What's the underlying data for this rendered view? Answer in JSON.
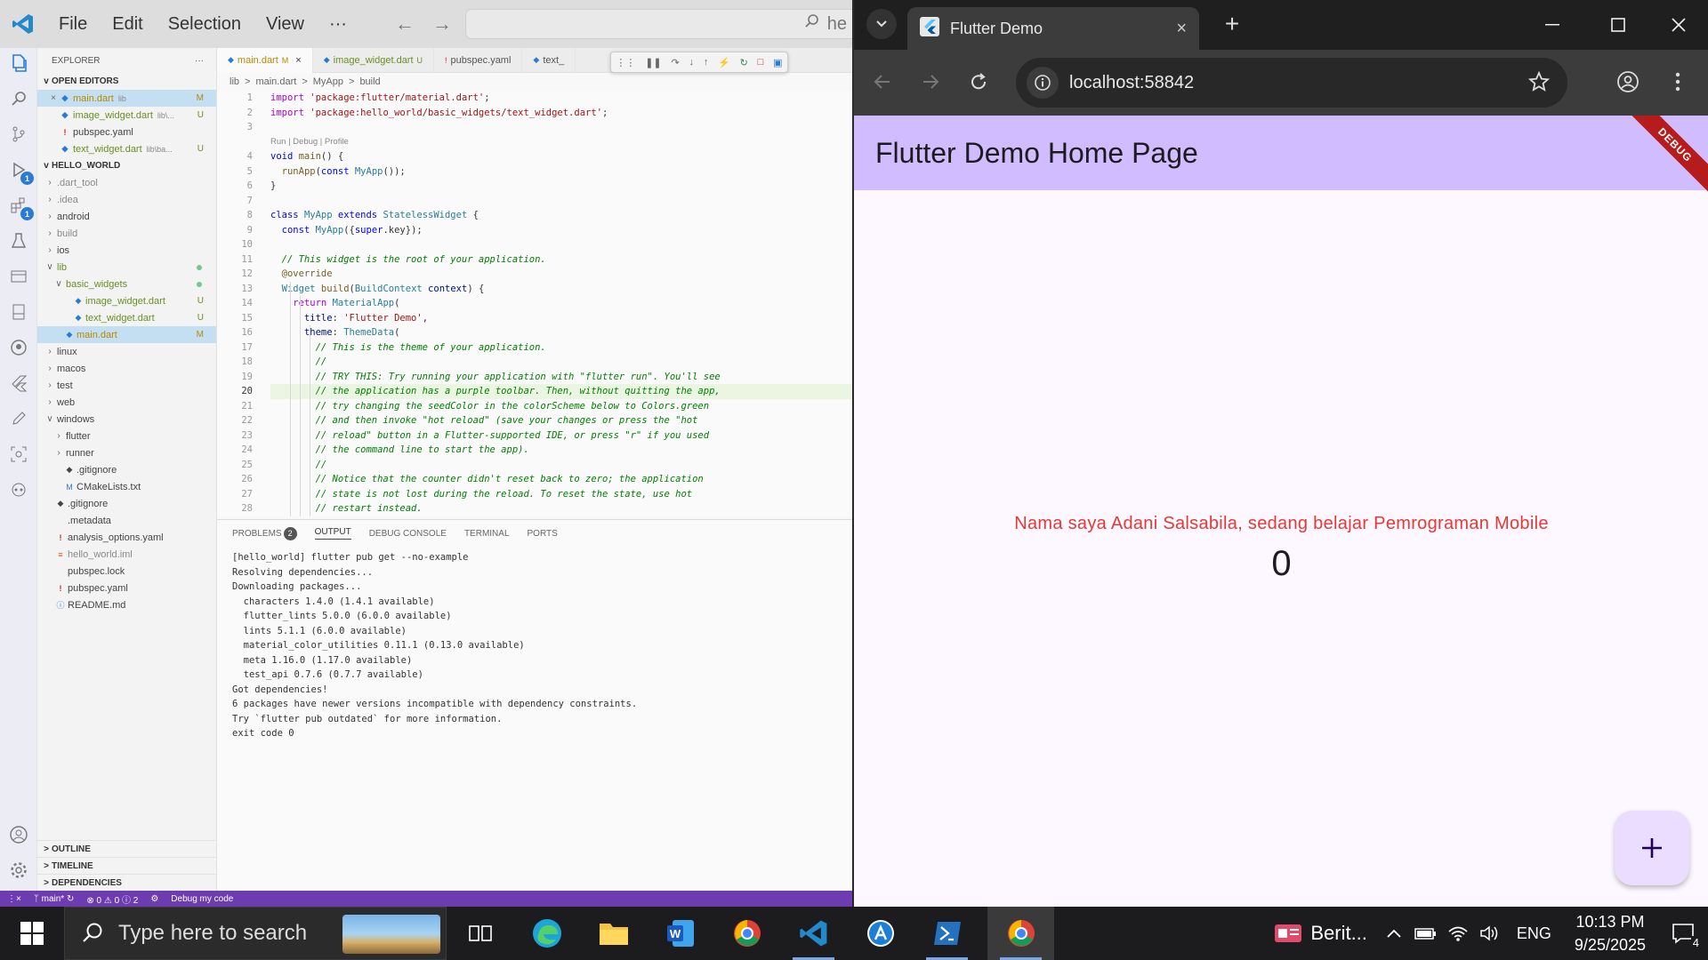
{
  "vscode": {
    "menu": [
      "File",
      "Edit",
      "Selection",
      "View",
      "···"
    ],
    "search_text": "he",
    "explorer_title": "EXPLORER",
    "open_editors_label": "OPEN EDITORS",
    "open_editors": [
      {
        "name": "main.dart",
        "detail": "lib",
        "status": "M",
        "close": true
      },
      {
        "name": "image_widget.dart",
        "detail": "lib\\...",
        "status": "U"
      },
      {
        "name": "pubspec.yaml",
        "detail": "",
        "status": ""
      },
      {
        "name": "text_widget.dart",
        "detail": "lib\\ba...",
        "status": "U"
      }
    ],
    "project_label": "HELLO_WORLD",
    "tree": [
      {
        "name": ".dart_tool",
        "indent": 0,
        "chev": ">",
        "color": "dim"
      },
      {
        "name": ".idea",
        "indent": 0,
        "chev": ">",
        "color": "dim"
      },
      {
        "name": "android",
        "indent": 0,
        "chev": ">"
      },
      {
        "name": "build",
        "indent": 0,
        "chev": ">",
        "color": "dim"
      },
      {
        "name": "ios",
        "indent": 0,
        "chev": ">"
      },
      {
        "name": "lib",
        "indent": 0,
        "chev": "v",
        "color": "grn",
        "dot": true
      },
      {
        "name": "basic_widgets",
        "indent": 1,
        "chev": "v",
        "color": "grn",
        "dot": true
      },
      {
        "name": "image_widget.dart",
        "indent": 2,
        "chev": "",
        "color": "grn",
        "status": "U"
      },
      {
        "name": "text_widget.dart",
        "indent": 2,
        "chev": "",
        "color": "grn",
        "status": "U"
      },
      {
        "name": "main.dart",
        "indent": 1,
        "chev": "",
        "color": "yel",
        "status": "M",
        "selected": true
      },
      {
        "name": "linux",
        "indent": 0,
        "chev": ">"
      },
      {
        "name": "macos",
        "indent": 0,
        "chev": ">"
      },
      {
        "name": "test",
        "indent": 0,
        "chev": ">"
      },
      {
        "name": "web",
        "indent": 0,
        "chev": ">"
      },
      {
        "name": "windows",
        "indent": 0,
        "chev": "v"
      },
      {
        "name": "flutter",
        "indent": 1,
        "chev": ">"
      },
      {
        "name": "runner",
        "indent": 1,
        "chev": ">"
      },
      {
        "name": ".gitignore",
        "indent": 1,
        "chev": ""
      },
      {
        "name": "CMakeLists.txt",
        "indent": 1,
        "chev": ""
      },
      {
        "name": ".gitignore",
        "indent": 0,
        "chev": ""
      },
      {
        "name": ".metadata",
        "indent": 0,
        "chev": ""
      },
      {
        "name": "analysis_options.yaml",
        "indent": 0,
        "chev": ""
      },
      {
        "name": "hello_world.iml",
        "indent": 0,
        "chev": "",
        "color": "dim"
      },
      {
        "name": "pubspec.lock",
        "indent": 0,
        "chev": ""
      },
      {
        "name": "pubspec.yaml",
        "indent": 0,
        "chev": ""
      },
      {
        "name": "README.md",
        "indent": 0,
        "chev": ""
      }
    ],
    "bottom_sections": [
      "OUTLINE",
      "TIMELINE",
      "DEPENDENCIES"
    ],
    "tabs": [
      {
        "name": "main.dart",
        "status": "M",
        "close": "×",
        "active": true
      },
      {
        "name": "image_widget.dart",
        "status": "U"
      },
      {
        "name": "pubspec.yaml",
        "status": ""
      },
      {
        "name": "text_",
        "status": ""
      }
    ],
    "breadcrumb": [
      "lib",
      ">",
      "main.dart",
      ">",
      "MyApp",
      ">",
      "build"
    ],
    "code_lens": "Run | Debug | Profile",
    "code": [
      [
        [
          "import ",
          "kp"
        ],
        [
          "'package:flutter/material.dart'",
          "str"
        ],
        [
          ";",
          ""
        ]
      ],
      [
        [
          "import ",
          "kp"
        ],
        [
          "'package:hello_world/basic_widgets/text_widget.dart'",
          "str"
        ],
        [
          ";",
          ""
        ]
      ],
      [],
      [
        [
          "void ",
          "kw"
        ],
        [
          "main",
          "fn"
        ],
        [
          "() {",
          ""
        ]
      ],
      [
        [
          "  ",
          ""
        ],
        [
          "runApp",
          "fn"
        ],
        [
          "(",
          ""
        ],
        [
          "const ",
          "kw"
        ],
        [
          "MyApp",
          "cls"
        ],
        [
          "());",
          ""
        ]
      ],
      [
        [
          "}",
          ""
        ]
      ],
      [],
      [
        [
          "class ",
          "kw"
        ],
        [
          "MyApp ",
          "cls"
        ],
        [
          "extends ",
          "kw"
        ],
        [
          "StatelessWidget ",
          "cls"
        ],
        [
          "{",
          ""
        ]
      ],
      [
        [
          "  ",
          ""
        ],
        [
          "const ",
          "kw"
        ],
        [
          "MyApp",
          "cls"
        ],
        [
          "({",
          ""
        ],
        [
          "super",
          "kw"
        ],
        [
          ".key});",
          ""
        ]
      ],
      [],
      [
        [
          "  // This widget is the root of your application.",
          "cmt"
        ]
      ],
      [
        [
          "  @override",
          "ann"
        ]
      ],
      [
        [
          "  ",
          ""
        ],
        [
          "Widget ",
          "cls"
        ],
        [
          "build",
          "fn"
        ],
        [
          "(",
          ""
        ],
        [
          "BuildContext ",
          "cls"
        ],
        [
          "context",
          "prm"
        ],
        [
          ") {",
          ""
        ]
      ],
      [
        [
          "    ",
          ""
        ],
        [
          "return ",
          "kp"
        ],
        [
          "MaterialApp",
          "cls"
        ],
        [
          "(",
          ""
        ]
      ],
      [
        [
          "      ",
          ""
        ],
        [
          "title",
          "prm"
        ],
        [
          ": ",
          ""
        ],
        [
          "'Flutter Demo'",
          "str"
        ],
        [
          ",",
          ""
        ]
      ],
      [
        [
          "      ",
          ""
        ],
        [
          "theme",
          "prm"
        ],
        [
          ": ",
          ""
        ],
        [
          "ThemeData",
          "cls"
        ],
        [
          "(",
          ""
        ]
      ],
      [
        [
          "        // This is the theme of your application.",
          "cmt"
        ]
      ],
      [
        [
          "        //",
          "cmt"
        ]
      ],
      [
        [
          "        // TRY THIS: Try running your application with \"flutter run\". You'll see",
          "cmt"
        ]
      ],
      [
        [
          "        // the application has a purple toolbar. Then, without quitting the app,",
          "cmt"
        ]
      ],
      [
        [
          "        // try changing the seedColor in the colorScheme below to Colors.green",
          "cmt"
        ]
      ],
      [
        [
          "        // and then invoke \"hot reload\" (save your changes or press the \"hot",
          "cmt"
        ]
      ],
      [
        [
          "        // reload\" button in a Flutter-supported IDE, or press \"r\" if you used",
          "cmt"
        ]
      ],
      [
        [
          "        // the command line to start the app).",
          "cmt"
        ]
      ],
      [
        [
          "        //",
          "cmt"
        ]
      ],
      [
        [
          "        // Notice that the counter didn't reset back to zero; the application",
          "cmt"
        ]
      ],
      [
        [
          "        // state is not lost during the reload. To reset the state, use hot",
          "cmt"
        ]
      ],
      [
        [
          "        // restart instead.",
          "cmt"
        ]
      ]
    ],
    "panel_tabs": [
      "PROBLEMS",
      "OUTPUT",
      "DEBUG CONSOLE",
      "TERMINAL",
      "PORTS"
    ],
    "problems_count": "2",
    "output": "[hello_world] flutter pub get --no-example\nResolving dependencies...\nDownloading packages...\n  characters 1.4.0 (1.4.1 available)\n  flutter_lints 5.0.0 (6.0.0 available)\n  lints 5.1.1 (6.0.0 available)\n  material_color_utilities 0.11.1 (0.13.0 available)\n  meta 1.16.0 (1.17.0 available)\n  test_api 0.7.6 (0.7.7 available)\nGot dependencies!\n6 packages have newer versions incompatible with dependency constraints.\nTry `flutter pub outdated` for more information.\nexit code 0",
    "status": {
      "branch": "main*",
      "errors": "0",
      "warnings": "0",
      "info": "2",
      "debug": "Debug my code"
    },
    "badge_run": "1",
    "badge_ext": "1"
  },
  "chrome": {
    "tab_title": "Flutter Demo",
    "url": "localhost:58842"
  },
  "app": {
    "title": "Flutter Demo Home Page",
    "banner": "DEBUG",
    "text": "Nama saya Adani Salsabila, sedang belajar Pemrograman Mobile",
    "counter": "0",
    "fab": "+"
  },
  "taskbar": {
    "search_placeholder": "Type here to search",
    "news": "Berit...",
    "lang": "ENG",
    "time": "10:13 PM",
    "date": "9/25/2025",
    "notifications": "4"
  },
  "colors": {
    "appbar": "#d0bcff",
    "fab": "#eaddff",
    "text_red": "#e53935",
    "status_bar": "#6c3cb0"
  }
}
